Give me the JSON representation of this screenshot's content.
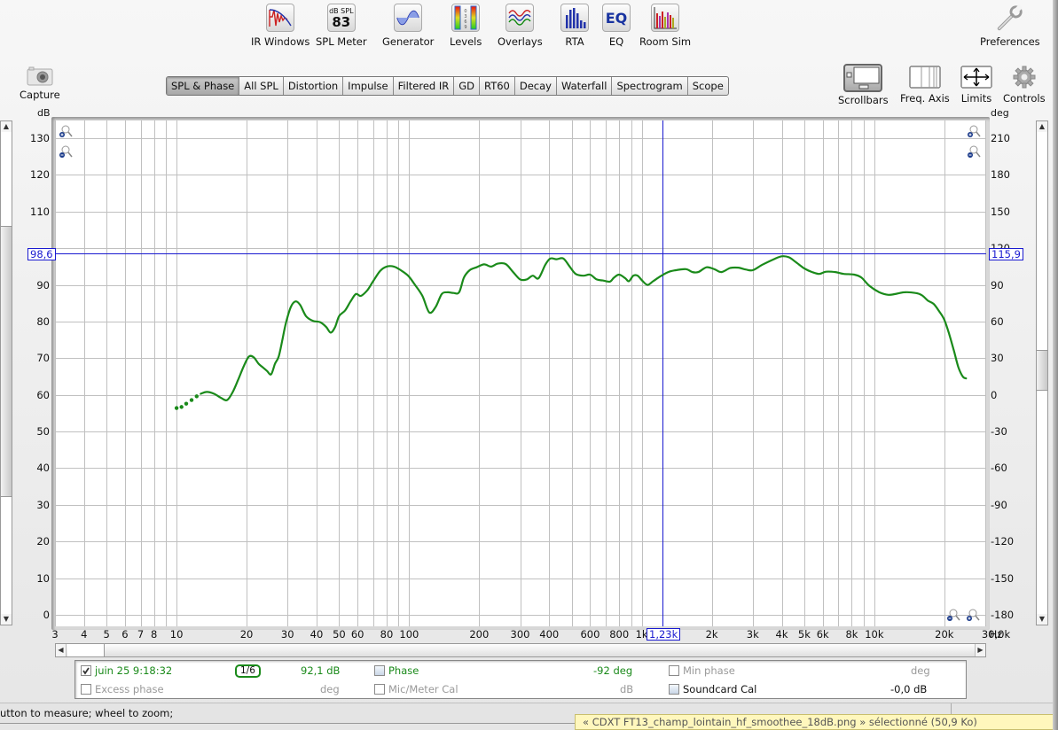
{
  "toolbar": {
    "items": [
      {
        "label": "IR Windows",
        "icon": "ir-windows-icon"
      },
      {
        "label": "SPL Meter",
        "icon": "spl-meter-icon",
        "meter_unit": "dB SPL",
        "meter_value": "83"
      },
      {
        "label": "Generator",
        "icon": "generator-icon"
      },
      {
        "label": "Levels",
        "icon": "levels-icon",
        "scale": "0369"
      },
      {
        "label": "Overlays",
        "icon": "overlays-icon"
      },
      {
        "label": "RTA",
        "icon": "rta-icon"
      },
      {
        "label": "EQ",
        "icon": "eq-icon",
        "text": "EQ"
      },
      {
        "label": "Room Sim",
        "icon": "room-sim-icon"
      }
    ],
    "preferences_label": "Preferences",
    "capture_label": "Capture",
    "right_tools": [
      {
        "label": "Scrollbars",
        "icon": "scrollbars-icon"
      },
      {
        "label": "Freq. Axis",
        "icon": "freq-axis-icon"
      },
      {
        "label": "Limits",
        "icon": "limits-icon"
      },
      {
        "label": "Controls",
        "icon": "gear-icon"
      }
    ]
  },
  "tabs": [
    {
      "label": "SPL & Phase",
      "active": true
    },
    {
      "label": "All SPL",
      "active": false
    },
    {
      "label": "Distortion",
      "active": false
    },
    {
      "label": "Impulse",
      "active": false
    },
    {
      "label": "Filtered IR",
      "active": false
    },
    {
      "label": "GD",
      "active": false
    },
    {
      "label": "RT60",
      "active": false
    },
    {
      "label": "Decay",
      "active": false
    },
    {
      "label": "Waterfall",
      "active": false
    },
    {
      "label": "Spectrogram",
      "active": false
    },
    {
      "label": "Scope",
      "active": false
    }
  ],
  "colors": {
    "curve": "#1a8a1a",
    "cursor": "#1a1ad0",
    "grid": "#c0c0c0"
  },
  "cursor": {
    "x_readout": "1,23k",
    "left_readout": "98,6",
    "right_readout": "115,9",
    "freq_hz": 1230,
    "spl_db": 98.6
  },
  "chart_data": {
    "type": "line",
    "title": "SPL & Phase",
    "xlabel": "Hz",
    "ylabel": "dB",
    "y2label": "deg",
    "xscale": "log",
    "xlim": [
      3,
      30000
    ],
    "ylim": [
      -3,
      135
    ],
    "y2lim": [
      -180,
      210
    ],
    "grid": true,
    "x_ticks": [
      {
        "v": 3,
        "l": "3"
      },
      {
        "v": 4,
        "l": "4"
      },
      {
        "v": 5,
        "l": "5"
      },
      {
        "v": 6,
        "l": "6"
      },
      {
        "v": 7,
        "l": "7"
      },
      {
        "v": 8,
        "l": "8"
      },
      {
        "v": 10,
        "l": "10"
      },
      {
        "v": 20,
        "l": "20"
      },
      {
        "v": 30,
        "l": "30"
      },
      {
        "v": 40,
        "l": "40"
      },
      {
        "v": 50,
        "l": "50"
      },
      {
        "v": 60,
        "l": "60"
      },
      {
        "v": 80,
        "l": "80"
      },
      {
        "v": 100,
        "l": "100"
      },
      {
        "v": 200,
        "l": "200"
      },
      {
        "v": 300,
        "l": "300"
      },
      {
        "v": 400,
        "l": "400"
      },
      {
        "v": 600,
        "l": "600"
      },
      {
        "v": 800,
        "l": "800"
      },
      {
        "v": 1000,
        "l": "1k"
      },
      {
        "v": 2000,
        "l": "2k"
      },
      {
        "v": 3000,
        "l": "3k"
      },
      {
        "v": 4000,
        "l": "4k"
      },
      {
        "v": 5000,
        "l": "5k"
      },
      {
        "v": 6000,
        "l": "6k"
      },
      {
        "v": 8000,
        "l": "8k"
      },
      {
        "v": 10000,
        "l": "10k"
      },
      {
        "v": 20000,
        "l": "20k"
      },
      {
        "v": 30000,
        "l": "30,0k"
      }
    ],
    "x_grid": [
      3,
      4,
      5,
      6,
      7,
      8,
      9,
      10,
      20,
      30,
      40,
      50,
      60,
      70,
      80,
      90,
      100,
      200,
      300,
      400,
      500,
      600,
      700,
      800,
      900,
      1000,
      2000,
      3000,
      4000,
      5000,
      6000,
      7000,
      8000,
      9000,
      10000,
      20000,
      30000
    ],
    "y_ticks": [
      0,
      10,
      20,
      30,
      40,
      50,
      60,
      70,
      80,
      90,
      100,
      110,
      120,
      130
    ],
    "y2_ticks": [
      -180,
      -150,
      -120,
      -90,
      -60,
      -30,
      0,
      30,
      60,
      90,
      120,
      150,
      180,
      210
    ],
    "series": [
      {
        "name": "juin 25 9:18:32",
        "color": "#1a8a1a",
        "dotted_start": [
          [
            10.0,
            56.4
          ],
          [
            10.5,
            56.7
          ],
          [
            11.0,
            57.6
          ],
          [
            11.6,
            58.6
          ],
          [
            12.2,
            59.6
          ]
        ],
        "points": [
          [
            12.7,
            60.3
          ],
          [
            13.5,
            60.8
          ],
          [
            14.5,
            60.3
          ],
          [
            15.5,
            59.2
          ],
          [
            16.5,
            58.6
          ],
          [
            17.5,
            61.0
          ],
          [
            18.5,
            64.5
          ],
          [
            19.5,
            68.0
          ],
          [
            20.5,
            70.5
          ],
          [
            21.5,
            70.2
          ],
          [
            22.5,
            68.5
          ],
          [
            23.5,
            67.5
          ],
          [
            24.5,
            66.5
          ],
          [
            25.5,
            65.6
          ],
          [
            26.5,
            68.5
          ],
          [
            27.5,
            70.5
          ],
          [
            28.5,
            75.0
          ],
          [
            29.5,
            79.5
          ],
          [
            31.0,
            84.0
          ],
          [
            32.5,
            85.5
          ],
          [
            34.0,
            84.5
          ],
          [
            36.0,
            81.5
          ],
          [
            38.5,
            80.2
          ],
          [
            41.5,
            79.8
          ],
          [
            44.0,
            78.5
          ],
          [
            46.0,
            77.0
          ],
          [
            48.0,
            78.5
          ],
          [
            50.0,
            81.5
          ],
          [
            53.0,
            83.0
          ],
          [
            56.0,
            85.5
          ],
          [
            59.0,
            87.5
          ],
          [
            62.0,
            87.0
          ],
          [
            66.0,
            88.5
          ],
          [
            70.0,
            91.0
          ],
          [
            75.0,
            93.8
          ],
          [
            80.0,
            95.0
          ],
          [
            86.0,
            95.0
          ],
          [
            92.0,
            94.0
          ],
          [
            99.0,
            92.5
          ],
          [
            106.0,
            90.0
          ],
          [
            114.0,
            87.0
          ],
          [
            122.0,
            82.5
          ],
          [
            130.0,
            84.0
          ],
          [
            138.0,
            87.5
          ],
          [
            146.0,
            88.0
          ],
          [
            155.0,
            87.8
          ],
          [
            164.0,
            88.0
          ],
          [
            172.0,
            92.0
          ],
          [
            182.0,
            94.0
          ],
          [
            195.0,
            94.8
          ],
          [
            210.0,
            95.6
          ],
          [
            225.0,
            95.0
          ],
          [
            240.0,
            95.8
          ],
          [
            260.0,
            95.7
          ],
          [
            280.0,
            93.5
          ],
          [
            300.0,
            91.5
          ],
          [
            320.0,
            91.5
          ],
          [
            340.0,
            92.5
          ],
          [
            360.0,
            91.8
          ],
          [
            385.0,
            95.5
          ],
          [
            405.0,
            97.2
          ],
          [
            430.0,
            97.0
          ],
          [
            460.0,
            97.2
          ],
          [
            490.0,
            95.0
          ],
          [
            520.0,
            93.0
          ],
          [
            560.0,
            92.5
          ],
          [
            600.0,
            92.8
          ],
          [
            640.0,
            91.5
          ],
          [
            680.0,
            91.2
          ],
          [
            730.0,
            90.9
          ],
          [
            760.0,
            92.0
          ],
          [
            800.0,
            92.8
          ],
          [
            850.0,
            91.8
          ],
          [
            880.0,
            91.0
          ],
          [
            920.0,
            92.5
          ],
          [
            960.0,
            92.5
          ],
          [
            1010.0,
            91.0
          ],
          [
            1060.0,
            90.0
          ],
          [
            1120.0,
            91.0
          ],
          [
            1200.0,
            92.3
          ],
          [
            1300.0,
            93.5
          ],
          [
            1400.0,
            94.0
          ],
          [
            1550.0,
            94.3
          ],
          [
            1650.0,
            93.5
          ],
          [
            1750.0,
            93.5
          ],
          [
            1900.0,
            94.8
          ],
          [
            2050.0,
            94.3
          ],
          [
            2200.0,
            93.5
          ],
          [
            2400.0,
            94.6
          ],
          [
            2600.0,
            94.7
          ],
          [
            2800.0,
            94.2
          ],
          [
            3000.0,
            94.0
          ],
          [
            3300.0,
            95.5
          ],
          [
            3700.0,
            97.0
          ],
          [
            4000.0,
            97.8
          ],
          [
            4300.0,
            97.5
          ],
          [
            4600.0,
            96.2
          ],
          [
            5000.0,
            94.5
          ],
          [
            5400.0,
            93.5
          ],
          [
            5800.0,
            93.0
          ],
          [
            6200.0,
            93.6
          ],
          [
            6800.0,
            93.5
          ],
          [
            7400.0,
            93.0
          ],
          [
            8200.0,
            92.8
          ],
          [
            8800.0,
            92.0
          ],
          [
            9500.0,
            89.8
          ],
          [
            10500.0,
            88.0
          ],
          [
            11500.0,
            87.3
          ],
          [
            12500.0,
            87.6
          ],
          [
            13500.0,
            88.0
          ],
          [
            15000.0,
            87.8
          ],
          [
            16000,
            87.2
          ],
          [
            17000.0,
            85.7
          ],
          [
            18000.0,
            84.8
          ],
          [
            19000.0,
            82.8
          ],
          [
            20000.0,
            80.5
          ],
          [
            21000.0,
            76.5
          ],
          [
            22000.0,
            72.0
          ],
          [
            23000.0,
            67.5
          ],
          [
            24000.0,
            65.0
          ],
          [
            24800.0,
            64.5
          ]
        ]
      }
    ]
  },
  "legend": {
    "measurement_checked": true,
    "measurement_name": "juin 25 9:18:32",
    "smoothing": "1/6",
    "spl_value": "92,1 dB",
    "phase_label": "Phase",
    "phase_value": "-92 deg",
    "min_phase_label": "Min phase",
    "min_phase_unit": "deg",
    "excess_phase_label": "Excess phase",
    "excess_phase_unit": "deg",
    "mic_cal_label": "Mic/Meter Cal",
    "mic_cal_unit": "dB",
    "soundcard_cal_label": "Soundcard Cal",
    "soundcard_cal_value": "-0,0 dB"
  },
  "axis": {
    "left_unit": "dB",
    "right_unit": "deg",
    "x_unit": "Hz"
  },
  "status": {
    "text": "utton to measure; wheel to zoom;",
    "notice": "« CDXT FT13_champ_lointain_hf_smoothee_18dB.png » sélectionné (50,9 Ko)"
  }
}
